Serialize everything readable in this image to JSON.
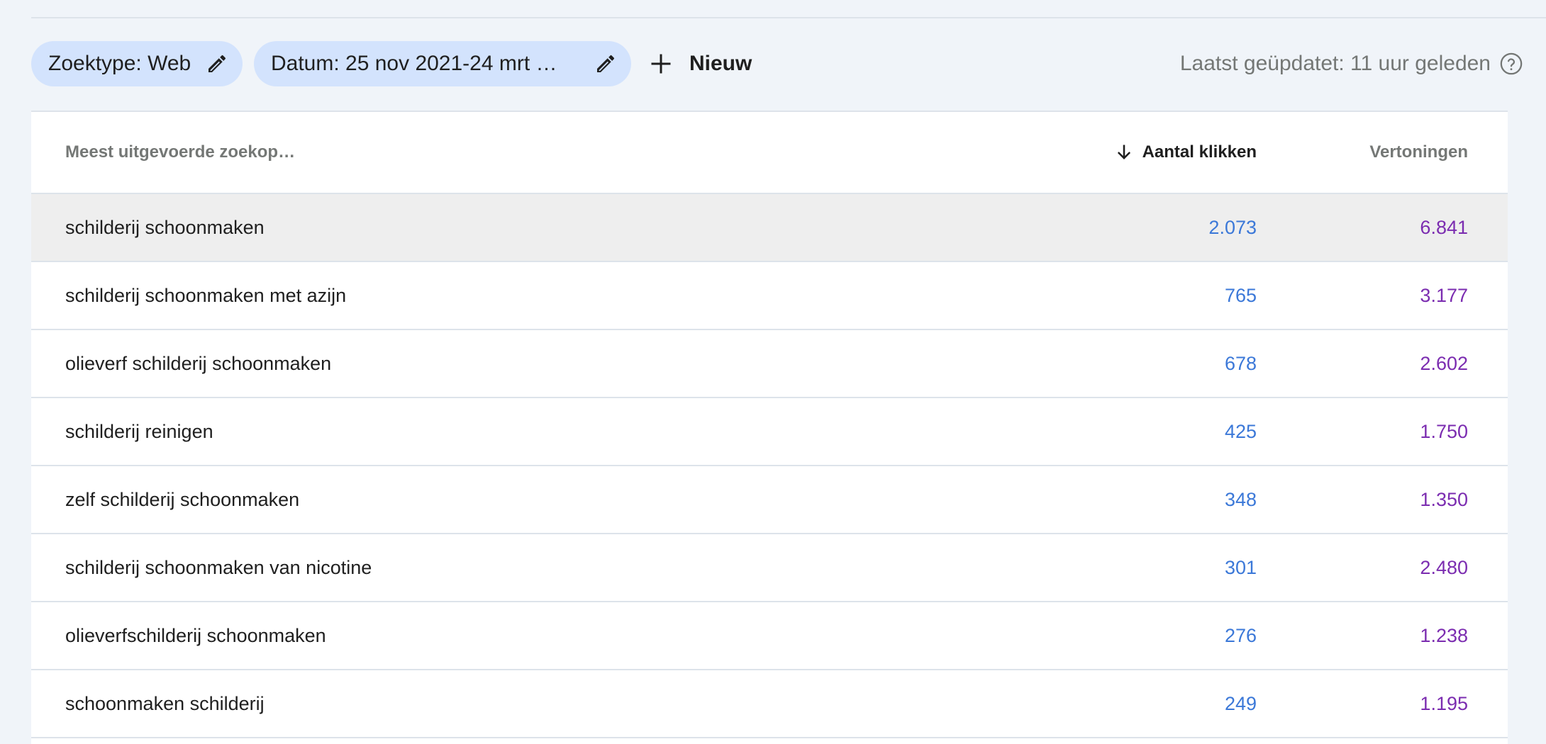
{
  "filters": {
    "search_type_chip": "Zoektype: Web",
    "date_chip": "Datum: 25 nov 2021-24 mrt …",
    "new_label": "Nieuw"
  },
  "last_updated": "Laatst geüpdatet: 11 uur geleden",
  "table": {
    "headers": {
      "query": "Meest uitgevoerde zoekop…",
      "clicks": "Aantal klikken",
      "impressions": "Vertoningen"
    },
    "sort_column": "clicks",
    "sort_direction": "descending",
    "rows": [
      {
        "query": "schilderij schoonmaken",
        "clicks": "2.073",
        "impressions": "6.841"
      },
      {
        "query": "schilderij schoonmaken met azijn",
        "clicks": "765",
        "impressions": "3.177"
      },
      {
        "query": "olieverf schilderij schoonmaken",
        "clicks": "678",
        "impressions": "2.602"
      },
      {
        "query": "schilderij reinigen",
        "clicks": "425",
        "impressions": "1.750"
      },
      {
        "query": "zelf schilderij schoonmaken",
        "clicks": "348",
        "impressions": "1.350"
      },
      {
        "query": "schilderij schoonmaken van nicotine",
        "clicks": "301",
        "impressions": "2.480"
      },
      {
        "query": "olieverfschilderij schoonmaken",
        "clicks": "276",
        "impressions": "1.238"
      },
      {
        "query": "schoonmaken schilderij",
        "clicks": "249",
        "impressions": "1.195"
      }
    ]
  },
  "colors": {
    "background": "#f0f4f9",
    "chip": "#d3e3fd",
    "clicks": "#3b78d8",
    "impressions": "#7b2cb0",
    "highlight_row": "#eeeeee"
  },
  "icons": {
    "edit": "pencil-icon",
    "add": "plus-icon",
    "help": "help-circle-icon",
    "sort": "arrow-down-icon"
  }
}
